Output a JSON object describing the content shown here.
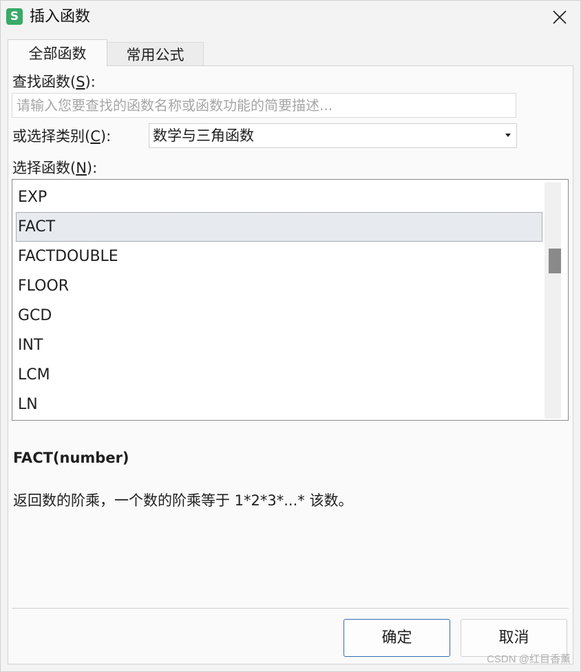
{
  "window": {
    "title": "插入函数",
    "app_icon_letter": "S"
  },
  "tabs": [
    {
      "label": "全部函数",
      "active": true
    },
    {
      "label": "常用公式",
      "active": false
    }
  ],
  "search": {
    "label": "查找函数(",
    "label_key": "S",
    "label_end": "):",
    "placeholder": "请输入您要查找的函数名称或函数功能的简要描述..."
  },
  "category": {
    "label": "或选择类别(",
    "label_key": "C",
    "label_end": "):",
    "value": "数学与三角函数"
  },
  "function_list": {
    "label": "选择函数(",
    "label_key": "N",
    "label_end": "):",
    "items": [
      "EXP",
      "FACT",
      "FACTDOUBLE",
      "FLOOR",
      "GCD",
      "INT",
      "LCM",
      "LN"
    ],
    "selected": "FACT"
  },
  "details": {
    "signature": "FACT(number)",
    "description": "返回数的阶乘，一个数的阶乘等于 1*2*3*...* 该数。"
  },
  "buttons": {
    "ok": "确定",
    "cancel": "取消"
  },
  "watermark": "CSDN @红目香薰",
  "colors": {
    "app_icon": "#3aa969",
    "ok_border": "#2d6fb0",
    "selected_row": "#e7ebf0"
  }
}
